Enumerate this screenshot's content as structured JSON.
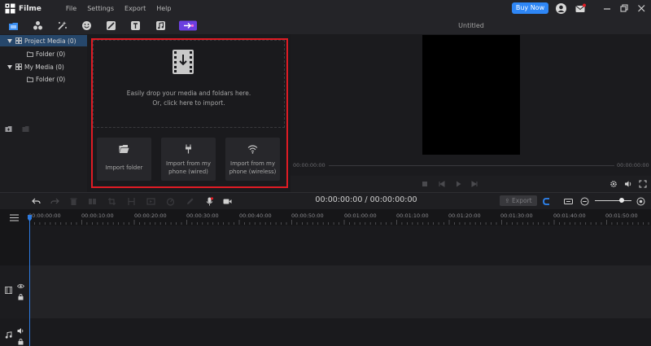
{
  "app": {
    "name": "Filme",
    "menu": [
      "File",
      "Settings",
      "Export",
      "Help"
    ],
    "buy_now": "Buy Now"
  },
  "preview": {
    "title": "Untitled",
    "time_left": "00:00:00:00",
    "time_right": "00:00:00:00"
  },
  "tree": {
    "items": [
      {
        "label": "Project Media (0)",
        "selected": true,
        "level": 0
      },
      {
        "label": "Folder (0)",
        "selected": false,
        "level": 1
      },
      {
        "label": "My Media (0)",
        "selected": false,
        "level": 0
      },
      {
        "label": "Folder (0)",
        "selected": false,
        "level": 1
      }
    ]
  },
  "media": {
    "drop_line1": "Easily drop your media and foldars here.",
    "drop_line2": "Or, click here to import.",
    "import_folder": "Import folder",
    "import_wired": [
      "Import from my",
      "phone (wired)"
    ],
    "import_wireless": [
      "Import from my",
      "phone (wireless)"
    ]
  },
  "timeline": {
    "timecode": "00:00:00:00 / 00:00:00:00",
    "export_label": "Export",
    "ruler": [
      "00:00:00:00",
      "00:00:10:00",
      "00:00:20:00",
      "00:00:30:00",
      "00:00:40:00",
      "00:00:50:00",
      "00:01:00:00",
      "00:01:10:00",
      "00:01:20:00",
      "00:01:30:00",
      "00:01:40:00",
      "00:01:50:00"
    ]
  },
  "colors": {
    "accent": "#2e86f5",
    "selection": "#26476b",
    "highlight_box": "#e01b24",
    "playhead": "#2e7be0"
  }
}
